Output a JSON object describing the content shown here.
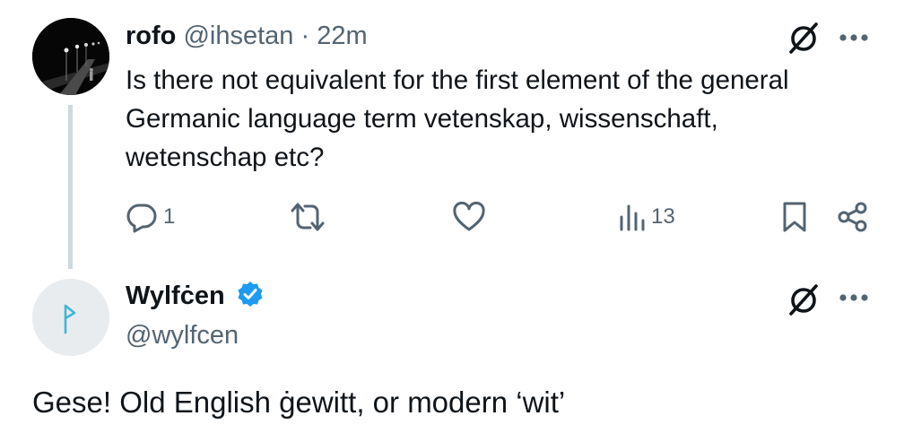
{
  "post": {
    "name": "rofo",
    "handle": "@ihsetan",
    "separator": "·",
    "time": "22m",
    "body_lines": [
      "Is there not equivalent for the first element of the general",
      "Germanic language term vetenskap, wissenschaft,",
      "wetenschap etc?"
    ],
    "actions": {
      "reply_count": "1",
      "repost_count": "",
      "like_count": "",
      "views_count": "13"
    }
  },
  "reply": {
    "name": "Wylfċen",
    "handle": "@wylfcen",
    "verified": true,
    "text": "Gese! Old English ġewitt, or modern ‘wit’"
  },
  "icons": {
    "grok": "slashed-circle-icon",
    "more": "more-dots-icon",
    "reply": "reply-bubble-icon",
    "repost": "repost-icon",
    "like": "heart-icon",
    "views": "views-bars-icon",
    "bookmark": "bookmark-icon",
    "share": "share-icon",
    "verified": "verified-badge-icon"
  },
  "colors": {
    "text": "#0f1419",
    "muted": "#536471",
    "verified": "#1d9bf0",
    "thread_line": "#cfd9de",
    "rune": "#3fb6d6"
  }
}
